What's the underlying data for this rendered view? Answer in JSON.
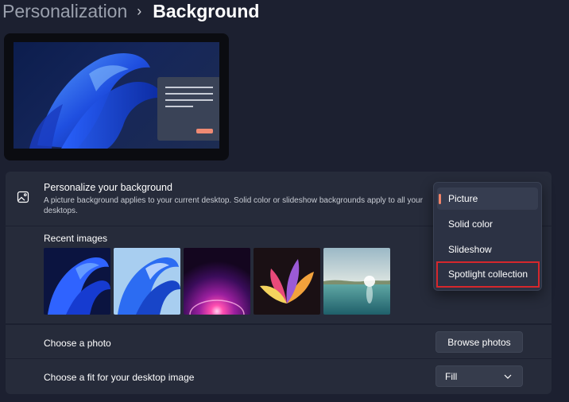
{
  "breadcrumb": {
    "parent": "Personalization",
    "separator": "›",
    "current": "Background"
  },
  "background_section": {
    "title": "Personalize your background",
    "description": "A picture background applies to your current desktop. Solid color or slideshow backgrounds apply to all your desktops.",
    "icon": "image-icon"
  },
  "background_type_dropdown": {
    "options": [
      "Picture",
      "Solid color",
      "Slideshow",
      "Spotlight collection"
    ],
    "selected": "Picture",
    "highlighted": "Spotlight collection"
  },
  "recent_images": {
    "label": "Recent images",
    "items": [
      "windows-bloom-dark",
      "windows-bloom-light",
      "purple-glow",
      "abstract-flower",
      "lake-sunrise"
    ]
  },
  "choose_photo": {
    "label": "Choose a photo",
    "button": "Browse photos"
  },
  "choose_fit": {
    "label": "Choose a fit for your desktop image",
    "value": "Fill",
    "icon": "chevron-down-icon"
  },
  "colors": {
    "background": "#1c2030",
    "panel": "#262b3a",
    "accent": "#f08368",
    "highlight_box": "#d6272c"
  }
}
